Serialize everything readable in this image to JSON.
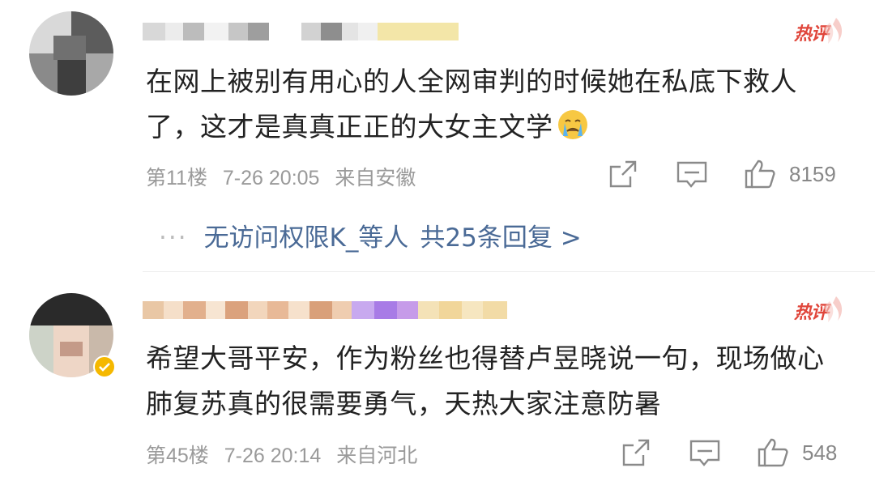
{
  "comments": [
    {
      "text": "在网上被别有用心的人全网审判的时候她在私底下救人了，这才是真真正正的大女主文学",
      "floor": "第11楼",
      "time": "7-26 20:05",
      "location": "来自安徽",
      "hot_label": "热评",
      "likes": "8159",
      "emoji": "crying-face",
      "replies": {
        "dots": "···",
        "users": "无访问权限K_等人",
        "count": "共25条回复 >"
      }
    },
    {
      "text": "希望大哥平安，作为粉丝也得替卢昱晓说一句，现场做心肺复苏真的很需要勇气，天热大家注意防暑",
      "floor": "第45楼",
      "time": "7-26 20:14",
      "location": "来自河北",
      "hot_label": "热评",
      "likes": "548"
    }
  ],
  "colors": {
    "text": "#222222",
    "meta": "#9a9a9a",
    "link": "#4a6a96",
    "hot": "#e0463b",
    "verified": "#f5b800"
  }
}
